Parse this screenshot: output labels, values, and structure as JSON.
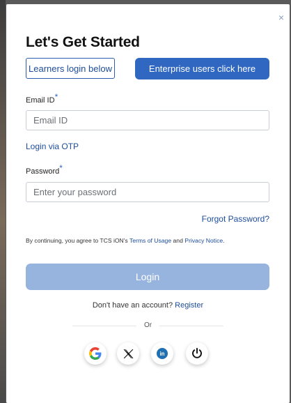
{
  "modal": {
    "close_label": "×",
    "title": "Let's Get Started"
  },
  "toggle": {
    "learners_label": "Learners login below",
    "enterprise_label": "Enterprise users click here"
  },
  "form": {
    "email_label": "Email ID",
    "email_required_mark": "*",
    "email_placeholder": "Email ID",
    "otp_link": "Login via OTP",
    "password_label": "Password",
    "password_required_mark": "*",
    "password_placeholder": "Enter your password",
    "forgot_link": "Forgot Password?"
  },
  "consent": {
    "prefix": "By continuing, you agree to TCS iON's ",
    "terms_link": "Terms of Usage",
    "conjunction": " and ",
    "privacy_link": "Privacy Notice",
    "suffix": "."
  },
  "login_button": "Login",
  "register": {
    "prompt": "Don't have an account? ",
    "link": "Register"
  },
  "divider_text": "Or",
  "social": [
    {
      "icon": "google-icon"
    },
    {
      "icon": "x-icon"
    },
    {
      "icon": "linkedin-icon"
    },
    {
      "icon": "power-icon"
    }
  ],
  "colors": {
    "accent": "#2f67c1",
    "link": "#1d4c9a",
    "login_disabled": "#97b4df"
  }
}
